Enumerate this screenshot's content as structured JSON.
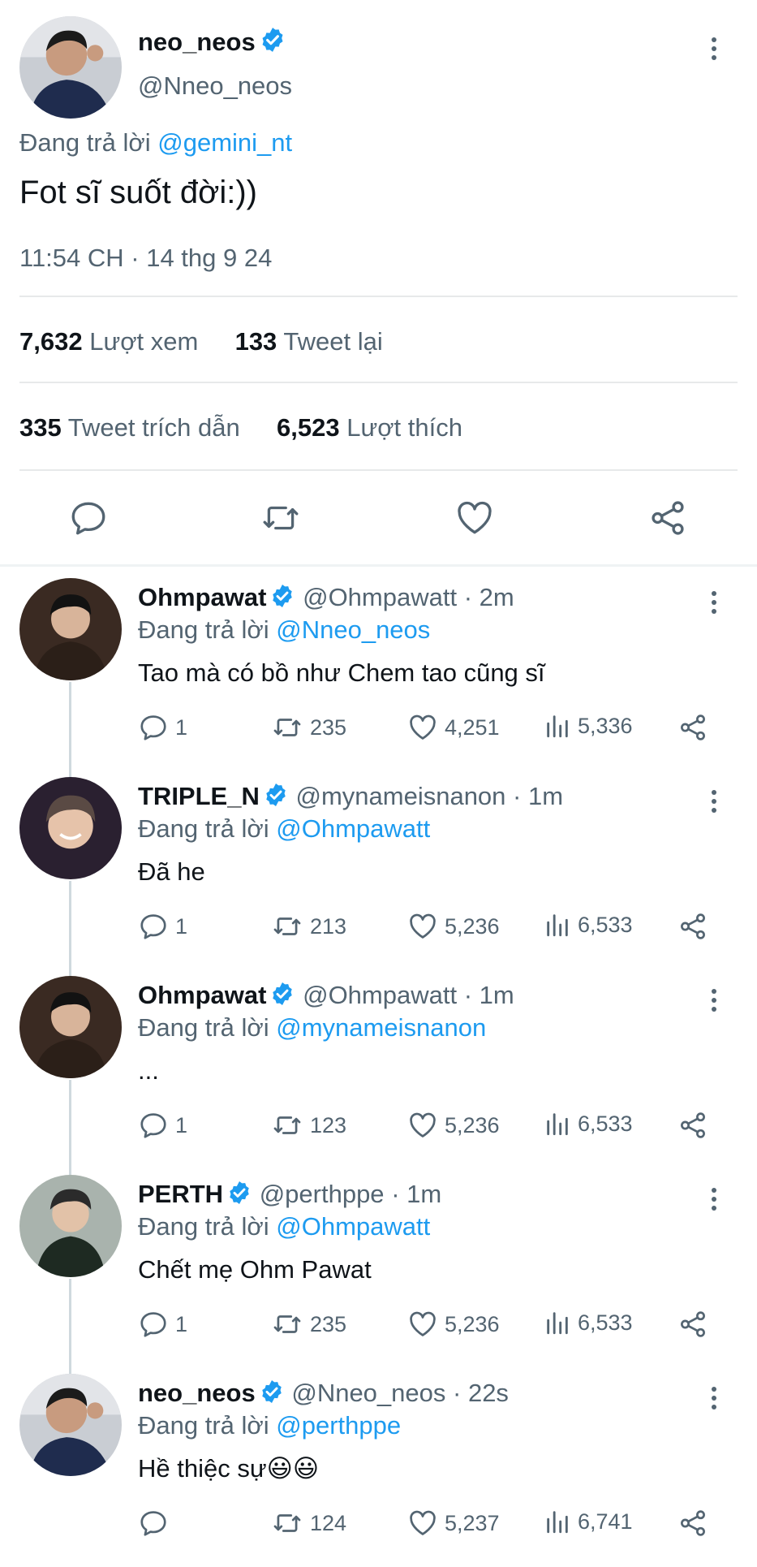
{
  "main_tweet": {
    "display_name": "neo_neos",
    "handle": "@Nneo_neos",
    "reply_prefix": "Đang trả lời",
    "reply_to": "@gemini_nt",
    "text": "Fot sĩ suốt đời:))",
    "timestamp": "11:54 CH · 14 thg 9 24",
    "stats": {
      "views_count": "7,632",
      "views_label": "Lượt xem",
      "retweets_count": "133",
      "retweets_label": "Tweet lại",
      "quotes_count": "335",
      "quotes_label": "Tweet trích dẫn",
      "likes_count": "6,523",
      "likes_label": "Lượt thích"
    },
    "actions": [
      "reply-icon",
      "retweet-icon",
      "like-icon",
      "share-icon"
    ]
  },
  "replies": [
    {
      "display_name": "Ohmpawat",
      "handle": "@Ohmpawatt",
      "time": "· 2m",
      "reply_prefix": "Đang trả lời",
      "reply_to": "@Nneo_neos",
      "text": "Tao mà có bồ như Chem tao cũng sĩ",
      "reply_count": "1",
      "retweet_count": "235",
      "like_count": "4,251",
      "view_count": "5,336"
    },
    {
      "display_name": "TRIPLE_N",
      "handle": "@mynameisnanon",
      "time": "· 1m",
      "reply_prefix": "Đang trả lời",
      "reply_to": "@Ohmpawatt",
      "text": "Đã he",
      "reply_count": "1",
      "retweet_count": "213",
      "like_count": "5,236",
      "view_count": "6,533"
    },
    {
      "display_name": "Ohmpawat",
      "handle": "@Ohmpawatt",
      "time": "· 1m",
      "reply_prefix": "Đang trả lời",
      "reply_to": "@mynameisnanon",
      "text": "...",
      "reply_count": "1",
      "retweet_count": "123",
      "like_count": "5,236",
      "view_count": "6,533"
    },
    {
      "display_name": "PERTH",
      "handle": "@perthppe",
      "time": "· 1m",
      "reply_prefix": "Đang trả lời",
      "reply_to": "@Ohmpawatt",
      "text": "Chết mẹ Ohm Pawat",
      "reply_count": "1",
      "retweet_count": "235",
      "like_count": "5,236",
      "view_count": "6,533"
    },
    {
      "display_name": "neo_neos",
      "handle": "@Nneo_neos",
      "time": "· 22s",
      "reply_prefix": "Đang trả lời",
      "reply_to": "@perthppe",
      "text": "Hề thiệc sự😃😃",
      "reply_count": "",
      "retweet_count": "124",
      "like_count": "5,237",
      "view_count": "6,741"
    }
  ],
  "colors": {
    "accent": "#1d9bf0",
    "text": "#0f1419",
    "muted": "#536471",
    "divider": "#e7e9ea"
  }
}
